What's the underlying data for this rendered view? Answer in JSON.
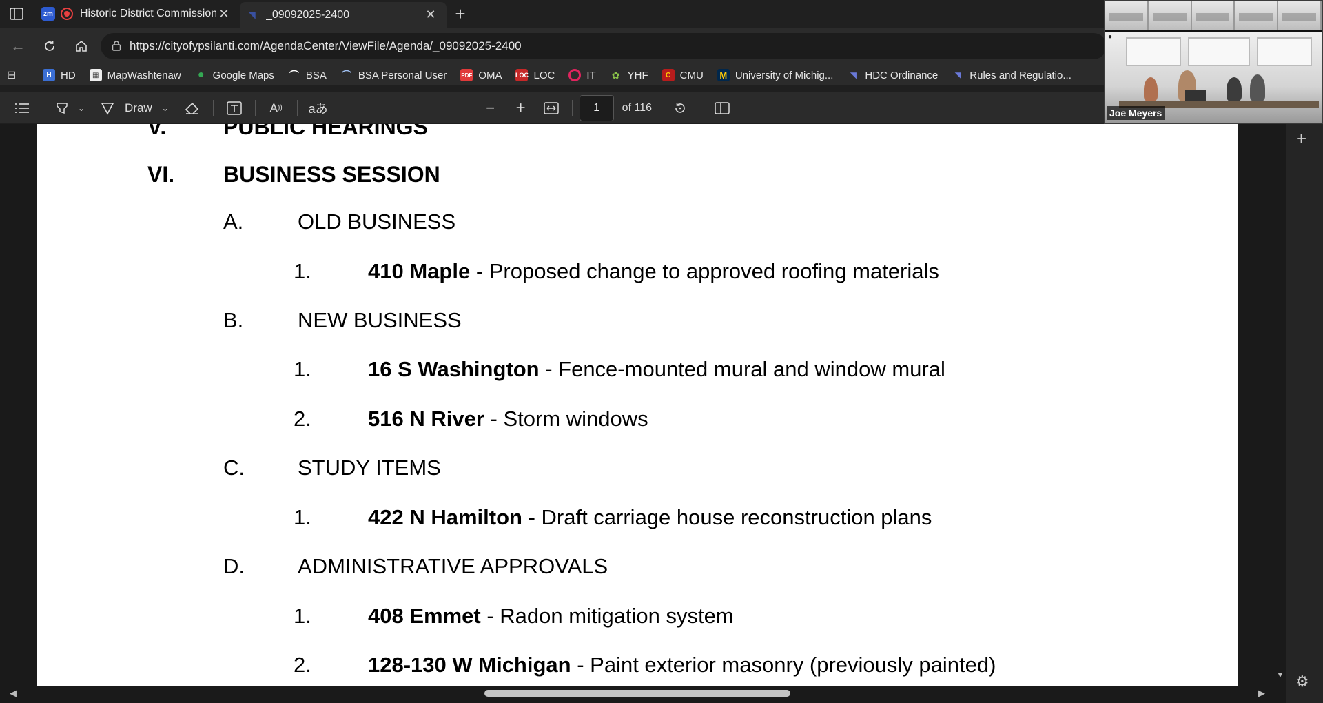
{
  "tabs": [
    {
      "title": "Historic District Commission",
      "favicon": "zm",
      "active": false
    },
    {
      "title": "_09092025-2400",
      "active": true
    }
  ],
  "address": {
    "url": "https://cityofypsilanti.com/AgendaCenter/ViewFile/Agenda/_09092025-2400"
  },
  "bookmarks": [
    {
      "label": "HD",
      "icon": "hd-icon",
      "color": "#3b6fd4"
    },
    {
      "label": "MapWashtenaw",
      "icon": "map-icon",
      "color": "#ffffff"
    },
    {
      "label": "Google Maps",
      "icon": "google-maps-icon",
      "color": "#34a853"
    },
    {
      "label": "BSA",
      "icon": "bsa-icon",
      "color": "#ffffff"
    },
    {
      "label": "BSA Personal User",
      "icon": "bsa-personal-icon",
      "color": "#4a7fd0"
    },
    {
      "label": "OMA",
      "icon": "pdf-icon",
      "color": "#e03a3a"
    },
    {
      "label": "LOC",
      "icon": "loc-icon",
      "color": "#c62828"
    },
    {
      "label": "IT",
      "icon": "it-icon",
      "color": "#e0245e"
    },
    {
      "label": "YHF",
      "icon": "yhf-icon",
      "color": "#8bc34a"
    },
    {
      "label": "CMU",
      "icon": "cmu-icon",
      "color": "#b71c1c"
    },
    {
      "label": "University of Michig...",
      "icon": "michigan-icon",
      "color": "#ffcb05"
    },
    {
      "label": "HDC Ordinance",
      "icon": "hdc-icon",
      "color": "#1a237e"
    },
    {
      "label": "Rules and Regulatio...",
      "icon": "rules-icon",
      "color": "#1a237e"
    }
  ],
  "pdf_toolbar": {
    "draw_label": "Draw",
    "page_current": "1",
    "page_total": "of 116"
  },
  "document": {
    "sections": [
      {
        "roman": "V.",
        "title": "PUBLIC HEARINGS"
      },
      {
        "roman": "VI.",
        "title": "BUSINESS SESSION"
      }
    ],
    "subsections": [
      {
        "letter": "A.",
        "title": "OLD BUSINESS"
      },
      {
        "letter": "B.",
        "title": "NEW BUSINESS"
      },
      {
        "letter": "C.",
        "title": "STUDY ITEMS"
      },
      {
        "letter": "D.",
        "title": "ADMINISTRATIVE APPROVALS"
      }
    ],
    "items": [
      {
        "num": "1.",
        "address": "410 Maple",
        "desc": " - Proposed change to approved roofing materials"
      },
      {
        "num": "1.",
        "address": "16 S Washington",
        "desc": " - Fence-mounted mural and window mural"
      },
      {
        "num": "2.",
        "address": "516 N River",
        "desc": " - Storm windows"
      },
      {
        "num": "1.",
        "address": "422 N Hamilton",
        "desc": " - Draft carriage house reconstruction plans"
      },
      {
        "num": "1.",
        "address": "408 Emmet",
        "desc": " - Radon mitigation system"
      },
      {
        "num": "2.",
        "address": "128-130 W Michigan",
        "desc": " - Paint exterior masonry (previously painted)"
      }
    ]
  },
  "video": {
    "participant_name": "Joe Meyers"
  }
}
